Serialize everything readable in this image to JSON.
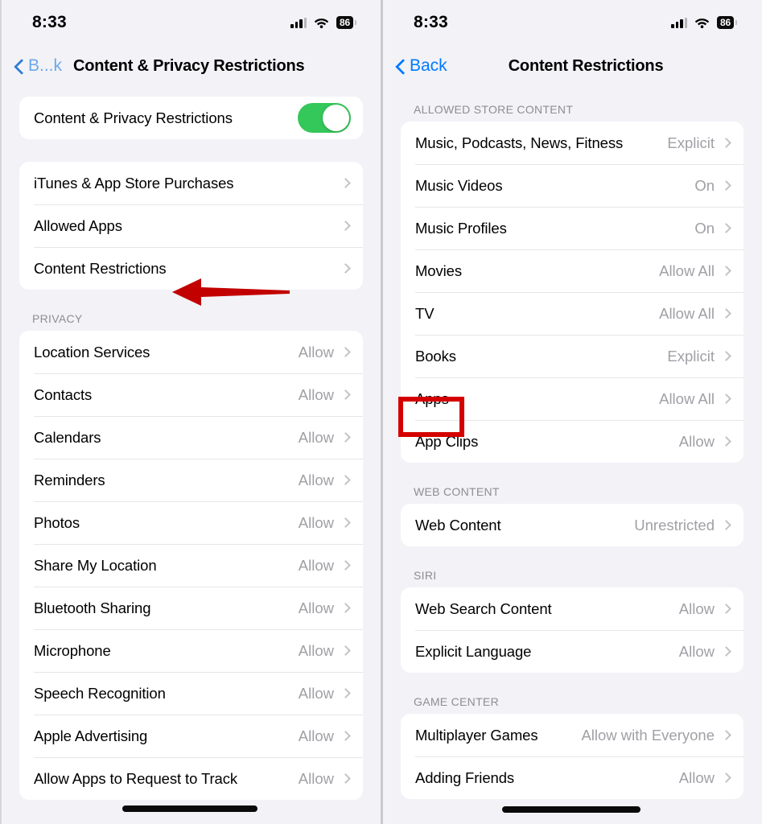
{
  "status_bar": {
    "time": "8:33",
    "battery_percent": "86",
    "signal_icon": "cellular-bars-icon",
    "wifi_icon": "wifi-icon",
    "battery_icon": "battery-icon"
  },
  "left_panel": {
    "nav": {
      "back_label": "B...k",
      "title": "Content & Privacy Restrictions",
      "back_icon": "chevron-left-icon"
    },
    "master_toggle": {
      "label": "Content & Privacy Restrictions",
      "state": "on",
      "color": "#34c759"
    },
    "groups": [
      {
        "header": "",
        "rows": [
          {
            "label": "iTunes & App Store Purchases",
            "value": ""
          },
          {
            "label": "Allowed Apps",
            "value": ""
          },
          {
            "label": "Content Restrictions",
            "value": ""
          }
        ]
      },
      {
        "header": "PRIVACY",
        "rows": [
          {
            "label": "Location Services",
            "value": "Allow"
          },
          {
            "label": "Contacts",
            "value": "Allow"
          },
          {
            "label": "Calendars",
            "value": "Allow"
          },
          {
            "label": "Reminders",
            "value": "Allow"
          },
          {
            "label": "Photos",
            "value": "Allow"
          },
          {
            "label": "Share My Location",
            "value": "Allow"
          },
          {
            "label": "Bluetooth Sharing",
            "value": "Allow"
          },
          {
            "label": "Microphone",
            "value": "Allow"
          },
          {
            "label": "Speech Recognition",
            "value": "Allow"
          },
          {
            "label": "Apple Advertising",
            "value": "Allow"
          },
          {
            "label": "Allow Apps to Request to Track",
            "value": "Allow"
          }
        ]
      }
    ]
  },
  "right_panel": {
    "nav": {
      "back_label": "Back",
      "title": "Content Restrictions",
      "back_icon": "chevron-left-icon"
    },
    "groups": [
      {
        "header": "ALLOWED STORE CONTENT",
        "rows": [
          {
            "label": "Music, Podcasts, News, Fitness",
            "value": "Explicit"
          },
          {
            "label": "Music Videos",
            "value": "On"
          },
          {
            "label": "Music Profiles",
            "value": "On"
          },
          {
            "label": "Movies",
            "value": "Allow All"
          },
          {
            "label": "TV",
            "value": "Allow All"
          },
          {
            "label": "Books",
            "value": "Explicit"
          },
          {
            "label": "Apps",
            "value": "Allow All"
          },
          {
            "label": "App Clips",
            "value": "Allow"
          }
        ]
      },
      {
        "header": "WEB CONTENT",
        "rows": [
          {
            "label": "Web Content",
            "value": "Unrestricted"
          }
        ]
      },
      {
        "header": "SIRI",
        "rows": [
          {
            "label": "Web Search Content",
            "value": "Allow"
          },
          {
            "label": "Explicit Language",
            "value": "Allow"
          }
        ]
      },
      {
        "header": "GAME CENTER",
        "rows": [
          {
            "label": "Multiplayer Games",
            "value": "Allow with Everyone"
          },
          {
            "label": "Adding Friends",
            "value": "Allow"
          }
        ]
      }
    ]
  },
  "annotations": {
    "arrow": {
      "name": "red-arrow-pointing-to-content-restrictions",
      "color": "#cc0000",
      "direction": "left"
    },
    "highlight_box": {
      "name": "red-highlight-box-around-apps",
      "color": "#d40000"
    }
  }
}
